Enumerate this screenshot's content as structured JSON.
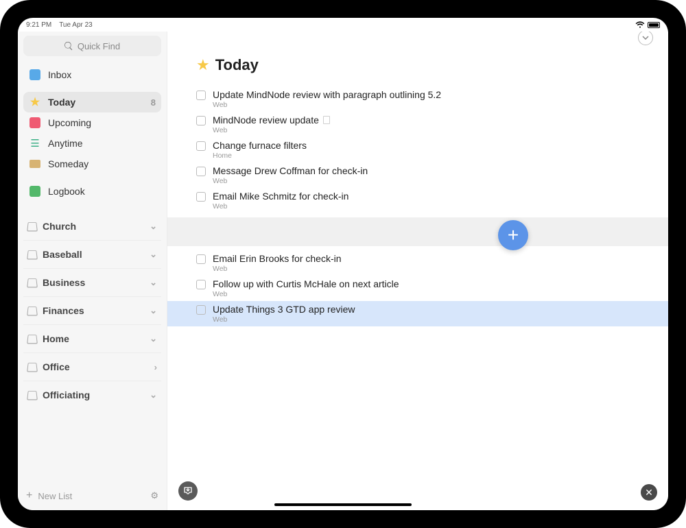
{
  "statusbar": {
    "time": "9:21 PM",
    "date": "Tue Apr 23"
  },
  "quickfind": {
    "placeholder": "Quick Find"
  },
  "nav": {
    "inbox": "Inbox",
    "today": "Today",
    "today_badge": "8",
    "upcoming": "Upcoming",
    "anytime": "Anytime",
    "someday": "Someday",
    "logbook": "Logbook"
  },
  "areas": [
    {
      "name": "Church",
      "chevron": "⌄"
    },
    {
      "name": "Baseball",
      "chevron": "⌄"
    },
    {
      "name": "Business",
      "chevron": "⌄"
    },
    {
      "name": "Finances",
      "chevron": "⌄"
    },
    {
      "name": "Home",
      "chevron": "⌄"
    },
    {
      "name": "Office",
      "chevron": "›"
    },
    {
      "name": "Officiating",
      "chevron": "⌄"
    }
  ],
  "sidebar_footer": {
    "newlist": "New List"
  },
  "page_title": "Today",
  "tasks": [
    {
      "title": "Update MindNode review with paragraph outlining 5.2",
      "tag": "Web",
      "has_note": false
    },
    {
      "title": "MindNode review update",
      "tag": "Web",
      "has_note": true
    },
    {
      "title": "Change furnace filters",
      "tag": "Home",
      "has_note": false
    },
    {
      "title": "Message Drew Coffman for check-in",
      "tag": "Web",
      "has_note": false
    },
    {
      "title": "Email Mike Schmitz for check-in",
      "tag": "Web",
      "has_note": false
    }
  ],
  "tasks2": [
    {
      "title": "Email Erin Brooks for check-in",
      "tag": "Web",
      "highlight": false
    },
    {
      "title": "Follow up with Curtis McHale on next article",
      "tag": "Web",
      "highlight": false
    },
    {
      "title": "Update Things 3 GTD app review",
      "tag": "Web",
      "highlight": true
    }
  ]
}
